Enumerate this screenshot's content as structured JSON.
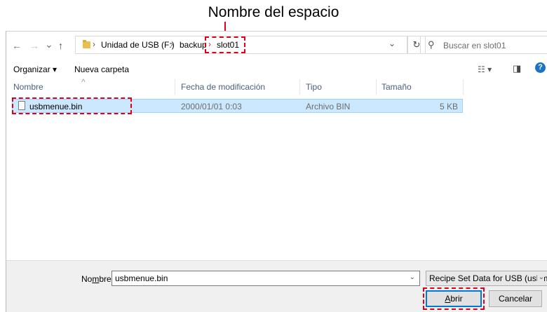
{
  "annotation": {
    "title": "Nombre del espacio"
  },
  "nav": {
    "back": "←",
    "forward": "→",
    "recent": "⌄",
    "up": "↑"
  },
  "address": {
    "drive": "Unidad de USB (F:)",
    "folder": "backup",
    "current": "slot01",
    "separator": "›",
    "dropdown": "⌄",
    "refresh": "↻"
  },
  "search": {
    "placeholder": "Buscar en slot01",
    "icon": "⚲"
  },
  "toolbar": {
    "organize": "Organizar ▾",
    "new_folder": "Nueva carpeta",
    "view_icon": "☷ ▾",
    "pane_icon": "◨",
    "help_icon": "?"
  },
  "columns": {
    "name": "Nombre",
    "modified": "Fecha de modificación",
    "type": "Tipo",
    "size": "Tamaño",
    "sort_caret": "^"
  },
  "files": [
    {
      "name": "usbmenue.bin",
      "modified": "2000/01/01 0:03",
      "type": "Archivo BIN",
      "size": "5 KB"
    }
  ],
  "footer": {
    "name_label_pre": "No",
    "name_label_u": "m",
    "name_label_post": "bre:",
    "filename": "usbmenue.bin",
    "filetype": "Recipe Set Data for USB (usbm",
    "open_pre": "",
    "open_u": "A",
    "open_post": "brir",
    "cancel": "Cancelar"
  },
  "colors": {
    "annotation_red": "#e0001b",
    "selection": "#cce8ff",
    "primary_border": "#0078d7"
  }
}
